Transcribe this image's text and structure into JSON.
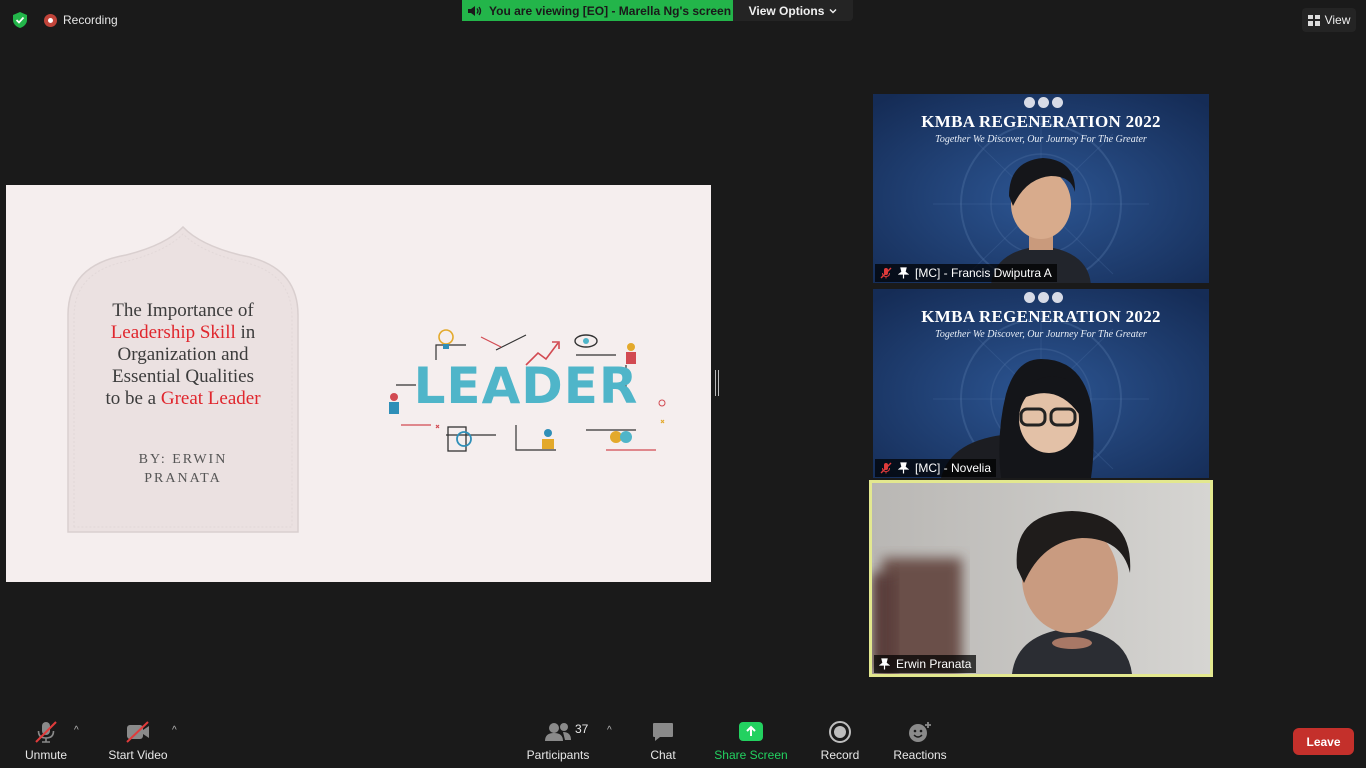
{
  "top_bar": {
    "recording_label": "Recording",
    "viewing_banner": "You are viewing [EO] - Marella Ng's screen",
    "view_options_label": "View Options",
    "view_button_label": "View"
  },
  "slide": {
    "title_lines": [
      {
        "parts": [
          {
            "text": "The Importance of",
            "red": false
          }
        ]
      },
      {
        "parts": [
          {
            "text": "Leadership Skill",
            "red": true
          },
          {
            "text": " in",
            "red": false
          }
        ]
      },
      {
        "parts": [
          {
            "text": "Organization and",
            "red": false
          }
        ]
      },
      {
        "parts": [
          {
            "text": "Essential Qualities",
            "red": false
          }
        ]
      },
      {
        "parts": [
          {
            "text": "to be a ",
            "red": false
          },
          {
            "text": "Great Leader",
            "red": true
          }
        ]
      }
    ],
    "byline_1": "BY: ERWIN",
    "byline_2": "PRANATA",
    "illustration_word": "LEADER",
    "accent_red": "#e0262d",
    "leader_color": "#4fb5c9"
  },
  "tiles": [
    {
      "event_title": "KMBA REGENERATION 2022",
      "event_subtitle": "Together We Discover, Our Journey For The Greater",
      "name": "[MC] - Francis Dwiputra A",
      "muted": true,
      "pinned": true
    },
    {
      "event_title": "KMBA REGENERATION 2022",
      "event_subtitle": "Together We Discover, Our Journey For The Greater",
      "name": "[MC] - Novelia",
      "muted": true,
      "pinned": true
    },
    {
      "name": "Erwin Pranata",
      "muted": false,
      "pinned": true,
      "active_speaker": true
    }
  ],
  "toolbar": {
    "unmute_label": "Unmute",
    "start_video_label": "Start Video",
    "participants_label": "Participants",
    "participants_count": "37",
    "chat_label": "Chat",
    "share_screen_label": "Share Screen",
    "record_label": "Record",
    "reactions_label": "Reactions",
    "leave_label": "Leave"
  },
  "colors": {
    "banner_green": "#23b54a",
    "share_green": "#23d160",
    "leave_red": "#c4302b",
    "active_border": "#e3e88f"
  }
}
